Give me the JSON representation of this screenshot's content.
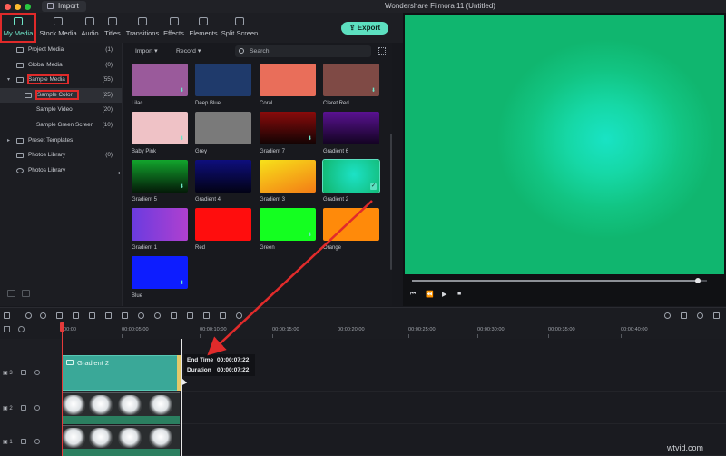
{
  "window": {
    "import_label": "Import",
    "title": "Wondershare Filmora 11 (Untitled)"
  },
  "tabs": [
    {
      "label": "My Media",
      "icon": "media-icon"
    },
    {
      "label": "Stock Media",
      "icon": "stock-icon"
    },
    {
      "label": "Audio",
      "icon": "music-icon"
    },
    {
      "label": "Titles",
      "icon": "titles-icon"
    },
    {
      "label": "Transitions",
      "icon": "transitions-icon"
    },
    {
      "label": "Effects",
      "icon": "effects-icon"
    },
    {
      "label": "Elements",
      "icon": "elements-icon"
    },
    {
      "label": "Split Screen",
      "icon": "split-screen-icon"
    }
  ],
  "export_label": "Export",
  "sidebar": {
    "items": [
      {
        "label": "Project Media",
        "count": "(1)"
      },
      {
        "label": "Global Media",
        "count": "(0)"
      },
      {
        "label": "Sample Media",
        "count": "(55)"
      },
      {
        "label": "Sample Color",
        "count": "(25)"
      },
      {
        "label": "Sample Video",
        "count": "(20)"
      },
      {
        "label": "Sample Green Screen",
        "count": "(10)"
      },
      {
        "label": "Preset Templates",
        "count": ""
      },
      {
        "label": "Photos Library",
        "count": "(0)"
      },
      {
        "label": "Photos Library",
        "count": ""
      }
    ]
  },
  "media_bar": {
    "import_label": "Import",
    "record_label": "Record",
    "search_placeholder": "Search"
  },
  "tiles": [
    {
      "label": "Lilac",
      "color": "#9a5a9b"
    },
    {
      "label": "Deep Blue",
      "color": "#1f3a6b"
    },
    {
      "label": "Coral",
      "color": "#e96e5a"
    },
    {
      "label": "Claret Red",
      "color": "#7f4a45"
    },
    {
      "label": "Baby Pink",
      "color": "#efc2c6"
    },
    {
      "label": "Grey",
      "color": "#7a7a7a"
    },
    {
      "label": "Gradient 7",
      "color": "linear-gradient(180deg,#8a0b0b,#110303)"
    },
    {
      "label": "Gradient 6",
      "color": "linear-gradient(180deg,#5a1292,#120320)"
    },
    {
      "label": "Gradient 5",
      "color": "linear-gradient(180deg,#12a52d,#041a08)"
    },
    {
      "label": "Gradient 4",
      "color": "linear-gradient(180deg,#0e0e7d,#020215)"
    },
    {
      "label": "Gradient 3",
      "color": "linear-gradient(160deg,#f7e21a,#f47c15)"
    },
    {
      "label": "Gradient 2",
      "color": "radial-gradient(circle at 55% 45%,#1ce2c6,#12b56c)"
    },
    {
      "label": "Gradient 1",
      "color": "linear-gradient(90deg,#6a3be0,#b040cf)"
    },
    {
      "label": "Red",
      "color": "#ff0d0d"
    },
    {
      "label": "Green",
      "color": "#14ff20"
    },
    {
      "label": "Orange",
      "color": "#ff8a0a"
    },
    {
      "label": "Blue",
      "color": "#0d1dff"
    }
  ],
  "ruler": [
    "00:00",
    "00:00:05:00",
    "00:00:10:00",
    "00:00:15:00",
    "00:00:20:00",
    "00:00:25:00",
    "00:00:30:00",
    "00:00:35:00",
    "00:00:40:00"
  ],
  "tracks": [
    {
      "num": "3"
    },
    {
      "num": "2"
    },
    {
      "num": "1"
    }
  ],
  "clip": {
    "label": "Gradient 2"
  },
  "tooltip": {
    "end_label": "End Time",
    "end_value": "00:00:07:22",
    "dur_label": "Duration",
    "dur_value": "00:00:07:22"
  },
  "progress": 0.97,
  "watermark": "wtvid.com"
}
